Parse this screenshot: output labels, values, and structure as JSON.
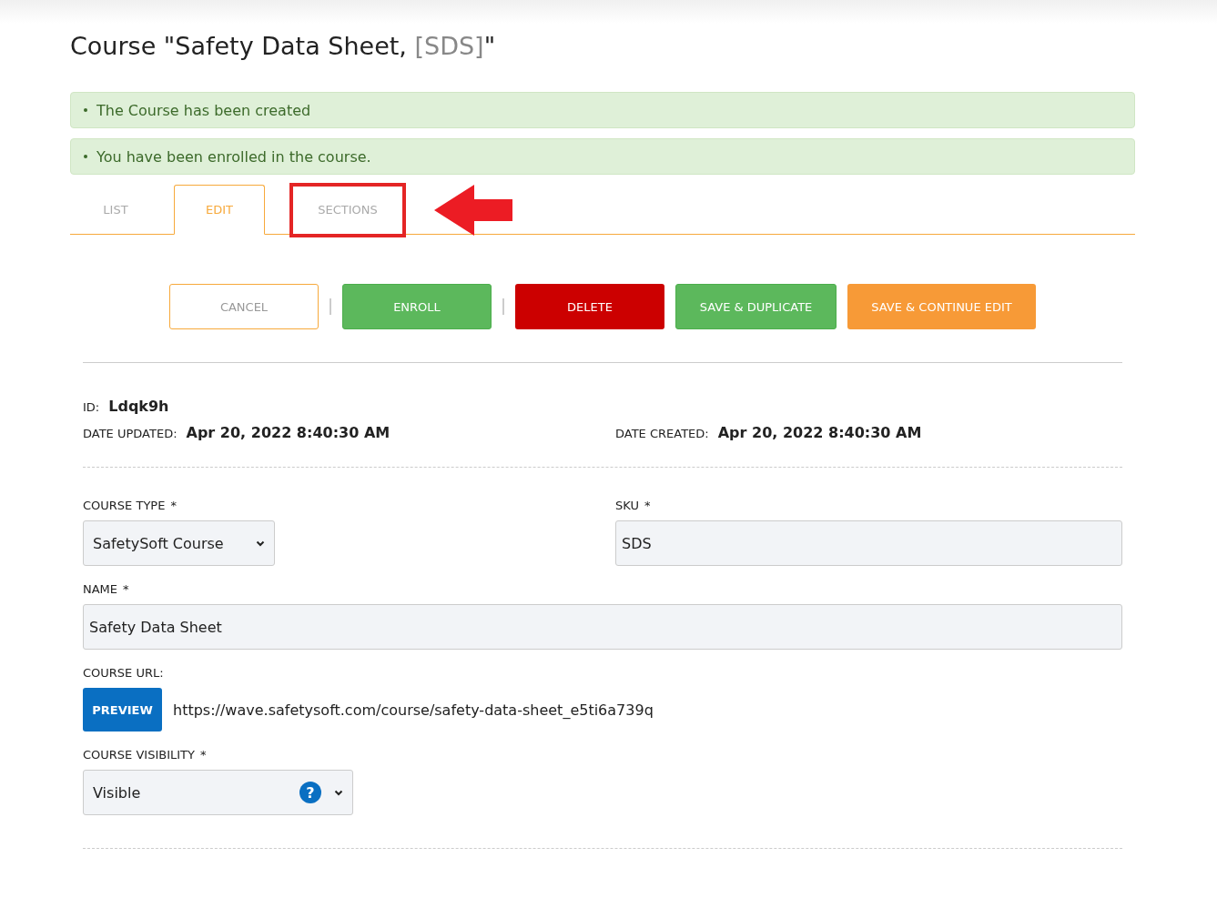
{
  "page_title": {
    "text": "Course \"Safety Data Sheet, ",
    "code": "[SDS]",
    "end": "\""
  },
  "alerts": [
    "The Course has been created",
    "You have been enrolled in the course."
  ],
  "tabs": [
    {
      "label": "LIST",
      "selected": false,
      "highlighted": false
    },
    {
      "label": "EDIT",
      "selected": true,
      "highlighted": false
    },
    {
      "label": "SECTIONS",
      "selected": false,
      "highlighted": true
    }
  ],
  "actions": [
    {
      "label": "CANCEL",
      "kind": "outline",
      "separator_after": true
    },
    {
      "label": "ENROLL",
      "kind": "green",
      "separator_after": true
    },
    {
      "label": "DELETE",
      "kind": "red",
      "separator_after": false
    },
    {
      "label": "SAVE & DUPLICATE",
      "kind": "green",
      "separator_after": false
    },
    {
      "label": "SAVE & CONTINUE EDIT",
      "kind": "orange",
      "separator_after": false
    }
  ],
  "meta": {
    "id_label": "ID:",
    "id": "Ldqk9h",
    "updated_label": "DATE UPDATED:",
    "updated": "Apr 20, 2022 8:40:30 AM",
    "created_label": "DATE CREATED:",
    "created": "Apr 20, 2022 8:40:30 AM"
  },
  "form": {
    "course_type": {
      "label": "COURSE TYPE",
      "required": "*",
      "value": "SafetySoft Course"
    },
    "sku": {
      "label": "SKU",
      "required": "*",
      "value": "SDS"
    },
    "name": {
      "label": "NAME",
      "required": "*",
      "value": "Safety Data Sheet"
    },
    "course_url": {
      "label": "COURSE URL:",
      "button": "PREVIEW",
      "url": "https://wave.safetysoft.com/course/safety-data-sheet_e5ti6a739q"
    },
    "visibility": {
      "label": "COURSE VISIBILITY",
      "required": "*",
      "value": "Visible",
      "help": "?"
    }
  }
}
